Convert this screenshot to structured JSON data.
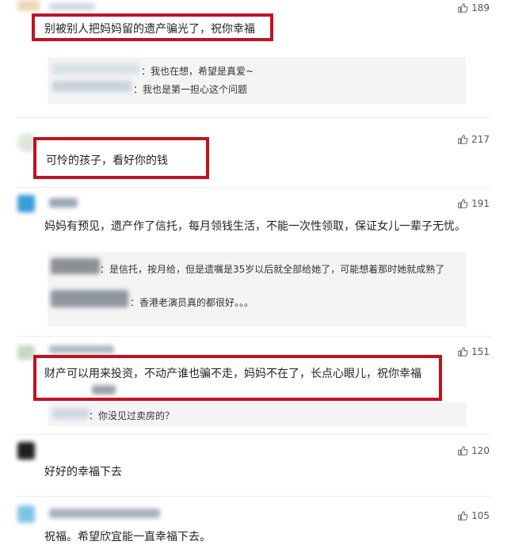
{
  "comments": [
    {
      "text": "别被别人把妈妈留的遗产骗光了，祝你幸福",
      "likes": "189",
      "replies": [
        {
          "text": "：我也在想，希望是真爱~"
        },
        {
          "text": "：我也是第一担心这个问题"
        }
      ]
    },
    {
      "text": "可怜的孩子，看好你的钱",
      "likes": "217"
    },
    {
      "text": "妈妈有预见，遗产作了信托，每月领钱生活，不能一次性领取，保证女儿一辈子无忧。",
      "likes": "191",
      "replies": [
        {
          "text": "：是信托，按月给，但是遗嘱是35岁以后就全部给她了，可能想着那时她就成熟了"
        },
        {
          "text": "：香港老演员真的都很好。。。"
        }
      ]
    },
    {
      "text": "财产可以用来投资，不动产谁也骗不走，妈妈不在了，长点心眼儿，祝你幸福",
      "likes": "151",
      "replies": [
        {
          "text": "：你没见过卖房的？"
        }
      ]
    },
    {
      "text": "好好的幸福下去",
      "likes": "120"
    },
    {
      "text": "祝福。希望欣宜能一直幸福下去。",
      "likes": "105"
    }
  ],
  "icons": {
    "like": "thumbs-up-icon"
  },
  "colors": {
    "highlight": "#c1121f"
  }
}
